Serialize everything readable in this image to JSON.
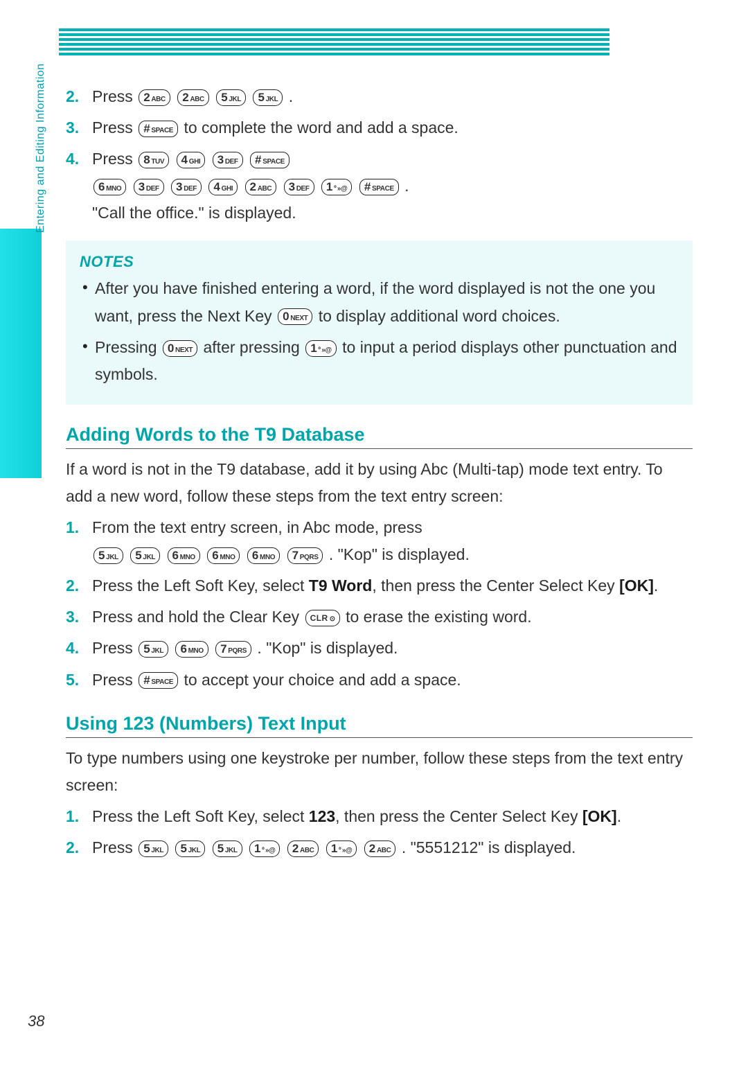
{
  "sideTab": "Entering and Editing Information",
  "pageNumber": "38",
  "keys": {
    "0next": {
      "main": "0",
      "sub": "NEXT"
    },
    "1sym": {
      "main": "1",
      "sub": "º »@"
    },
    "2abc": {
      "main": "2",
      "sub": "ABC"
    },
    "3def": {
      "main": "3",
      "sub": "DEF"
    },
    "4ghi": {
      "main": "4",
      "sub": "GHI"
    },
    "5jkl": {
      "main": "5",
      "sub": "JKL"
    },
    "6mno": {
      "main": "6",
      "sub": "MNO"
    },
    "7pqrs": {
      "main": "7",
      "sub": "PQRS"
    },
    "8tuv": {
      "main": "8",
      "sub": "TUV"
    },
    "hashspace": {
      "main": "#",
      "sub": "SPACE"
    },
    "clr": {
      "main": "CLR",
      "sub": "⊙"
    }
  },
  "topSteps": {
    "s2": {
      "num": "2.",
      "lead": "Press ",
      "trail": "."
    },
    "s3": {
      "num": "3.",
      "lead": "Press ",
      "trail": " to complete the word and add a space."
    },
    "s4": {
      "num": "4.",
      "lead": "Press ",
      "trail": ".",
      "result": "\"Call the office.\" is displayed."
    }
  },
  "notes": {
    "title": "NOTES",
    "n1a": "After you have finished entering a word, if the word displayed is not the one you want, press the Next Key ",
    "n1b": " to display additional word choices.",
    "n2a": "Pressing ",
    "n2b": " after pressing ",
    "n2c": " to input a period displays other punctuation and symbols."
  },
  "sectionA": {
    "title": "Adding Words to the T9 Database",
    "intro": "If a word is not in the T9 database, add it by using Abc (Multi-tap) mode text entry. To add a new word, follow these steps from the text entry screen:",
    "s1": {
      "num": "1.",
      "a": "From the text entry screen, in Abc mode, press",
      "b": ". \"Kop\" is displayed."
    },
    "s2": {
      "num": "2.",
      "a": "Press the Left Soft Key, select ",
      "bold": "T9 Word",
      "b": ", then press the Center Select Key ",
      "bold2": "[OK]",
      "c": "."
    },
    "s3": {
      "num": "3.",
      "a": "Press and hold the Clear Key ",
      "b": " to erase the existing word."
    },
    "s4": {
      "num": "4.",
      "a": "Press ",
      "b": ". \"Kop\" is displayed."
    },
    "s5": {
      "num": "5.",
      "a": "Press ",
      "b": " to accept your choice and add a space."
    }
  },
  "sectionB": {
    "title": "Using 123 (Numbers) Text Input",
    "intro": "To type numbers using one keystroke per number, follow these steps from the text entry screen:",
    "s1": {
      "num": "1.",
      "a": "Press the Left Soft Key, select ",
      "bold": "123",
      "b": ", then press the Center Select Key ",
      "bold2": "[OK]",
      "c": "."
    },
    "s2": {
      "num": "2.",
      "a": "Press ",
      "b": ". \"5551212\" is displayed."
    }
  }
}
